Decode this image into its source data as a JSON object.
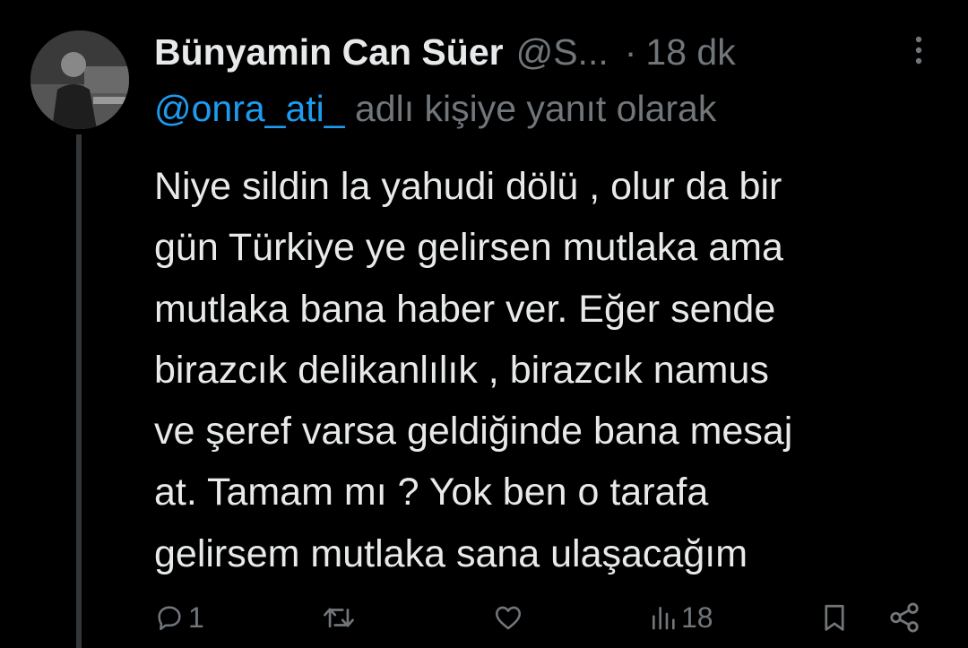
{
  "tweet": {
    "author_name": "Bünyamin Can Süer",
    "author_handle": "@S...",
    "separator": "·",
    "time": "18 dk",
    "reply_mention": "@onra_ati_",
    "reply_suffix": "adlı kişiye yanıt olarak",
    "text_lines": [
      "Niye sildin la yahudi dölü , olur da bir",
      "gün Türkiye ye gelirsen mutlaka ama",
      "mutlaka bana haber ver. Eğer sende",
      "birazcık delikanlılık , birazcık namus",
      "ve şeref varsa geldiğinde bana mesaj",
      "at. Tamam mı ? Yok ben o tarafa",
      "gelirsem mutlaka sana ulaşacağım"
    ]
  },
  "actions": {
    "reply_count": "1",
    "retweet_count": "",
    "like_count": "",
    "view_count": "18"
  },
  "icons": {
    "more": "more-vertical-icon",
    "reply": "reply-icon",
    "retweet": "retweet-icon",
    "like": "heart-icon",
    "views": "bar-chart-icon",
    "bookmark": "bookmark-icon",
    "share": "share-icon"
  },
  "colors": {
    "background": "#000000",
    "text": "#e7e9ea",
    "muted": "#71767b",
    "link": "#1d9bf0",
    "thread_line": "#333639"
  }
}
